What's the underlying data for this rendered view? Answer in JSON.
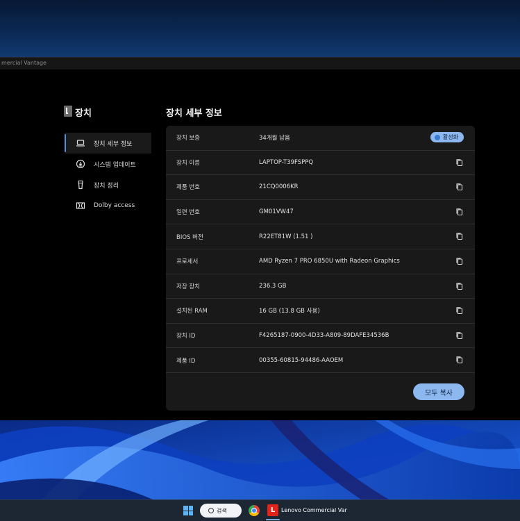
{
  "window": {
    "title": "mercial Vantage"
  },
  "sidebar": {
    "title": "장치",
    "items": [
      {
        "label": "장치 세부 정보",
        "icon": "laptop-icon",
        "active": true
      },
      {
        "label": "시스템 업데이트",
        "icon": "download-icon",
        "active": false
      },
      {
        "label": "장치 정리",
        "icon": "trash-icon",
        "active": false
      },
      {
        "label": "Dolby access",
        "icon": "dolby-icon",
        "active": false
      }
    ]
  },
  "main": {
    "title": "장치 세부 정보",
    "rows": [
      {
        "key": "장치 보증",
        "value": "34개월 남음",
        "badge": "활성화"
      },
      {
        "key": "장치 이름",
        "value": "LAPTOP-T39FSPPQ"
      },
      {
        "key": "제품 번호",
        "value": "21CQ0006KR"
      },
      {
        "key": "일련 번호",
        "value": "GM01VW47"
      },
      {
        "key": "BIOS 버전",
        "value": "R22ET81W (1.51 )"
      },
      {
        "key": "프로세서",
        "value": "AMD Ryzen 7 PRO 6850U with Radeon Graphics"
      },
      {
        "key": "저장 장치",
        "value": "236.3 GB"
      },
      {
        "key": "설치된 RAM",
        "value": "16 GB (13.8 GB 사용)"
      },
      {
        "key": "장치 ID",
        "value": "F4265187-0900-4D33-A809-89DAFE34536B"
      },
      {
        "key": "제품 ID",
        "value": "00355-60815-94486-AAOEM"
      }
    ],
    "copy_all_label": "모두 복사"
  },
  "taskbar": {
    "search_label": "검색",
    "app_label": "Lenovo Commercial Var",
    "lenovo_letter": "L"
  },
  "colors": {
    "accent": "#8cb8ef",
    "active_bar": "#4f92e0",
    "background": "#000000",
    "card": "#191919"
  }
}
